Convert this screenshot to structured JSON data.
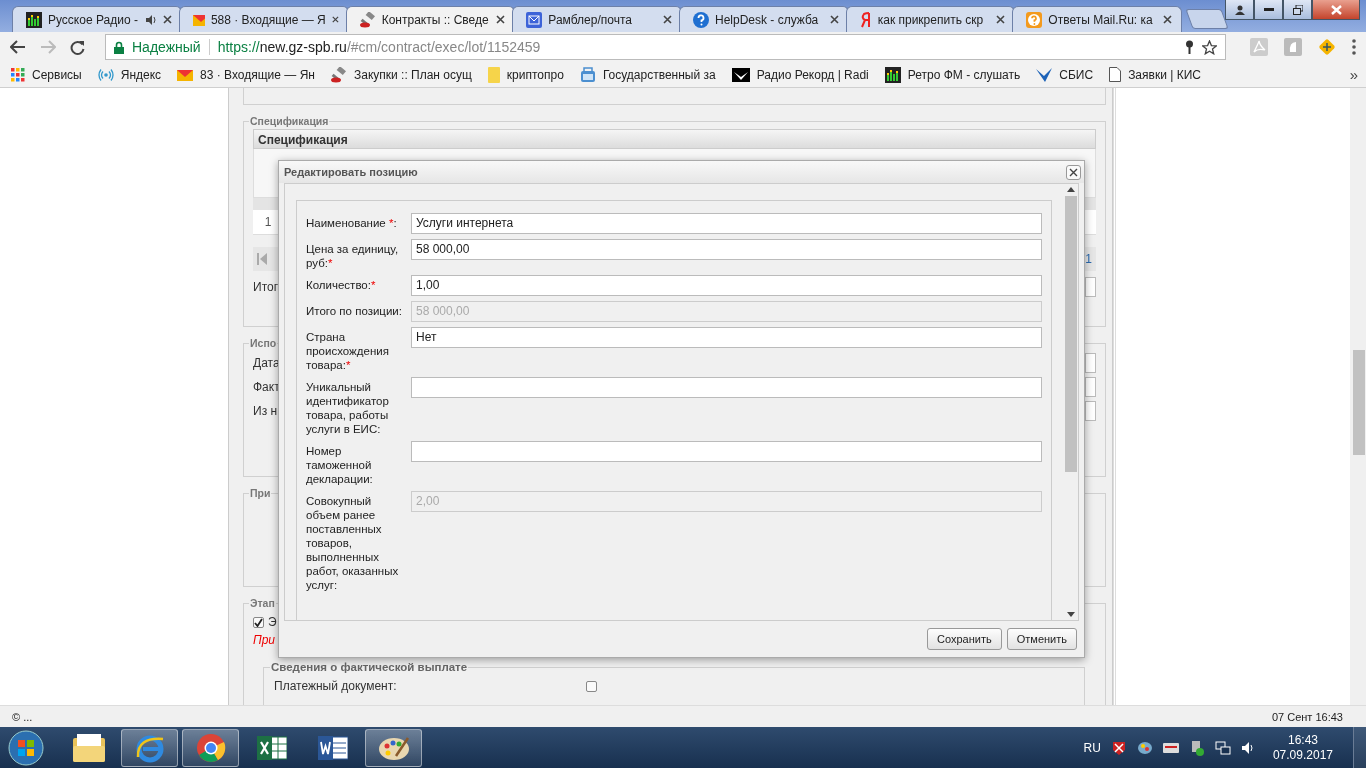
{
  "browser": {
    "tabs": [
      {
        "title": "Русское Радио -",
        "selected": false,
        "audio": true
      },
      {
        "title": "588 · Входящие — Я",
        "selected": false,
        "audio": false
      },
      {
        "title": "Контракты :: Сведе",
        "selected": true,
        "audio": false
      },
      {
        "title": "Рамблер/почта",
        "selected": false,
        "audio": false
      },
      {
        "title": "HelpDesk - служба",
        "selected": false,
        "audio": false
      },
      {
        "title": "как прикрепить скр",
        "selected": false,
        "audio": false
      },
      {
        "title": "Ответы Mail.Ru: ка",
        "selected": false,
        "audio": false
      }
    ],
    "address": {
      "security": "Надежный",
      "scheme": "https://",
      "host": "new.gz-spb.ru",
      "path": "/#cm/contract/exec/lot/1152459"
    },
    "bookmarks": [
      "Сервисы",
      "Яндекс",
      "83 · Входящие — Ян",
      "Закупки :: План осущ",
      "криптопро",
      "Государственный за",
      "Радио Рекорд | Radi",
      "Ретро ФМ - слушать",
      "СБИС",
      "Заявки | КИС"
    ],
    "bookmarks_more": "»"
  },
  "page": {
    "spec": {
      "legend": "Спецификация",
      "grid_title": "Спецификация",
      "row_number": "1",
      "pager_page": "1",
      "total_label": "Итог"
    },
    "executor": {
      "legend": "Испо",
      "labels": [
        "Дата",
        "Факт",
        "Из н"
      ]
    },
    "section_3": {
      "legend": "При"
    },
    "stages": {
      "legend": "Этап",
      "checkbox": {
        "label": "Э",
        "checked": true
      },
      "note": "При",
      "payment": {
        "legend": "Сведения о фактической выплате",
        "label": "Платежный документ:",
        "checked": false
      }
    }
  },
  "dialog": {
    "title": "Редактировать позицию",
    "fields": [
      {
        "label": "Наименование ",
        "mark": "*",
        "tail": ":",
        "value": "Услуги интернета",
        "disabled": false
      },
      {
        "label": "Цена за единицу, руб:",
        "mark": "*",
        "value": "58 000,00",
        "disabled": false
      },
      {
        "label": "Количество:",
        "mark": "*",
        "value": "1,00",
        "disabled": false
      },
      {
        "label": "Итого по позиции:",
        "value": "58 000,00",
        "disabled": true
      },
      {
        "label": "Страна происхождения товара:",
        "mark": "*",
        "value": "Нет",
        "disabled": false
      },
      {
        "label": "Уникальный идентификатор товара, работы услуги в ЕИС:",
        "disabled": false
      },
      {
        "label": "Номер таможенной декларации:",
        "disabled": false
      },
      {
        "label": "Совокупный объем ранее поставленных товаров, выполненных работ, оказанных услуг:",
        "value": "2,00",
        "disabled": true
      }
    ],
    "buttons": [
      "Сохранить",
      "Отменить"
    ]
  },
  "status_bar": {
    "left": "© ...",
    "right": "07 Сент 16:43"
  },
  "taskbar": {
    "apps": [
      {
        "open": false
      },
      {
        "open": true
      },
      {
        "open": true
      },
      {
        "open": false
      },
      {
        "open": false
      },
      {
        "open": true
      }
    ],
    "language": "RU",
    "time": "16:43",
    "date": "07.09.2017"
  }
}
